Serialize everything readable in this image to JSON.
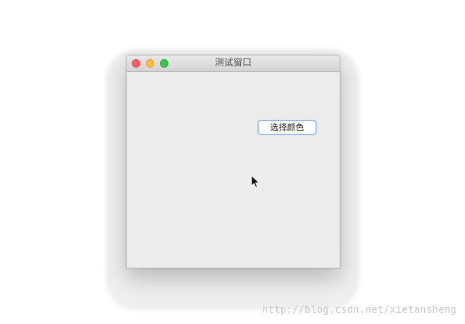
{
  "window": {
    "title": "测试窗口",
    "controls": {
      "close_color": "#fc605c",
      "minimize_color": "#fdbc40",
      "zoom_color": "#34c84a"
    }
  },
  "content": {
    "choose_color_button_label": "选择颜色"
  },
  "watermark": {
    "text": "http://blog.csdn.net/xietansheng"
  }
}
